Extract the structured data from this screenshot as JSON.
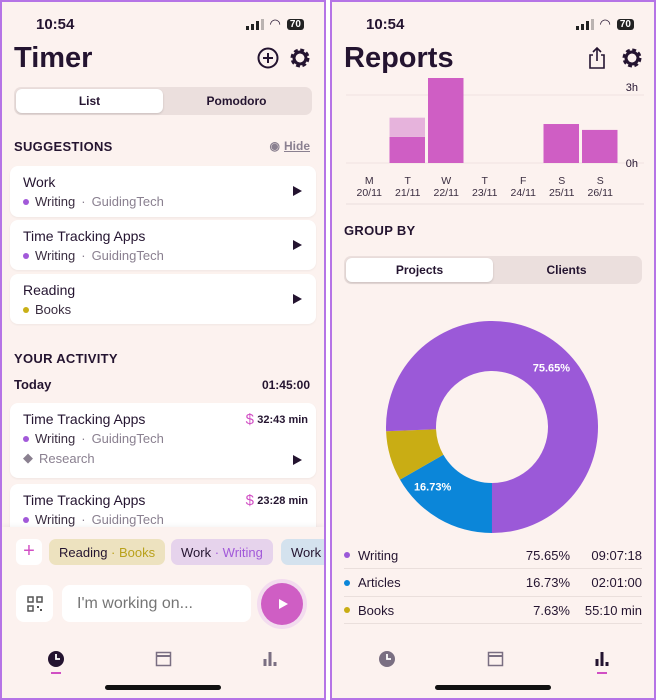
{
  "status": {
    "time": "10:54",
    "battery": "70"
  },
  "timer": {
    "title": "Timer",
    "segments": [
      "List",
      "Pomodoro"
    ],
    "suggestions_header": "SUGGESTIONS",
    "hide_label": "Hide",
    "suggestions": [
      {
        "title": "Work",
        "project": "Writing",
        "client": "GuidingTech",
        "color": "#a259d9"
      },
      {
        "title": "Time Tracking Apps",
        "project": "Writing",
        "client": "GuidingTech",
        "color": "#a259d9"
      },
      {
        "title": "Reading",
        "project": "Books",
        "client": "",
        "color": "#c9b017"
      }
    ],
    "activity_header": "YOUR ACTIVITY",
    "day": "Today",
    "day_total": "01:45:00",
    "entries": [
      {
        "title": "Time Tracking Apps",
        "project": "Writing",
        "client": "GuidingTech",
        "tag": "Research",
        "billable": "$",
        "duration": "32:43 min"
      },
      {
        "title": "Time Tracking Apps",
        "project": "Writing",
        "client": "GuidingTech",
        "billable": "$",
        "duration": "23:28 min"
      }
    ],
    "chips": [
      {
        "task": "Reading",
        "project": "Books",
        "bg": "#ede2bf",
        "fg": "#b9a11b"
      },
      {
        "task": "Work",
        "project": "Writing",
        "bg": "#e6d3ec",
        "fg": "#a259d9"
      },
      {
        "task": "Work",
        "project": "",
        "bg": "#d4e2ee",
        "fg": "#333"
      }
    ],
    "input_placeholder": "I'm working on...",
    "active_tab": "timer"
  },
  "reports": {
    "title": "Reports",
    "group_by": "GROUP BY",
    "segments": [
      "Projects",
      "Clients"
    ],
    "active_tab": "reports"
  },
  "chart_data": [
    {
      "type": "bar",
      "stacked": true,
      "categories": [
        "M 20/11",
        "T 21/11",
        "W 22/11",
        "T 23/11",
        "F 24/11",
        "S 25/11",
        "S 26/11"
      ],
      "day_letters": [
        "M",
        "T",
        "W",
        "T",
        "F",
        "S",
        "S"
      ],
      "dates": [
        "20/11",
        "21/11",
        "22/11",
        "23/11",
        "24/11",
        "25/11",
        "26/11"
      ],
      "series": [
        {
          "values": [
            0,
            1.15,
            3.75,
            0,
            0,
            1.72,
            1.46
          ],
          "color": "#cf5ec4"
        },
        {
          "values": [
            0,
            0.85,
            0,
            0,
            0,
            0,
            0
          ],
          "color": "#e6b3dc"
        }
      ],
      "ytick_labels": [
        "3h",
        "0h"
      ],
      "ylim": [
        0,
        3.75
      ],
      "grid": true
    },
    {
      "type": "pie",
      "donut": true,
      "labels": [
        "Writing",
        "Articles",
        "Books"
      ],
      "values": [
        75.65,
        16.73,
        7.63
      ],
      "value_labels": [
        "75.65%",
        "16.73%",
        "7.63%"
      ],
      "durations": [
        "09:07:18",
        "02:01:00",
        "55:10 min"
      ],
      "colors": [
        "#9b59d8",
        "#0b86d9",
        "#c9ad14"
      ]
    }
  ]
}
